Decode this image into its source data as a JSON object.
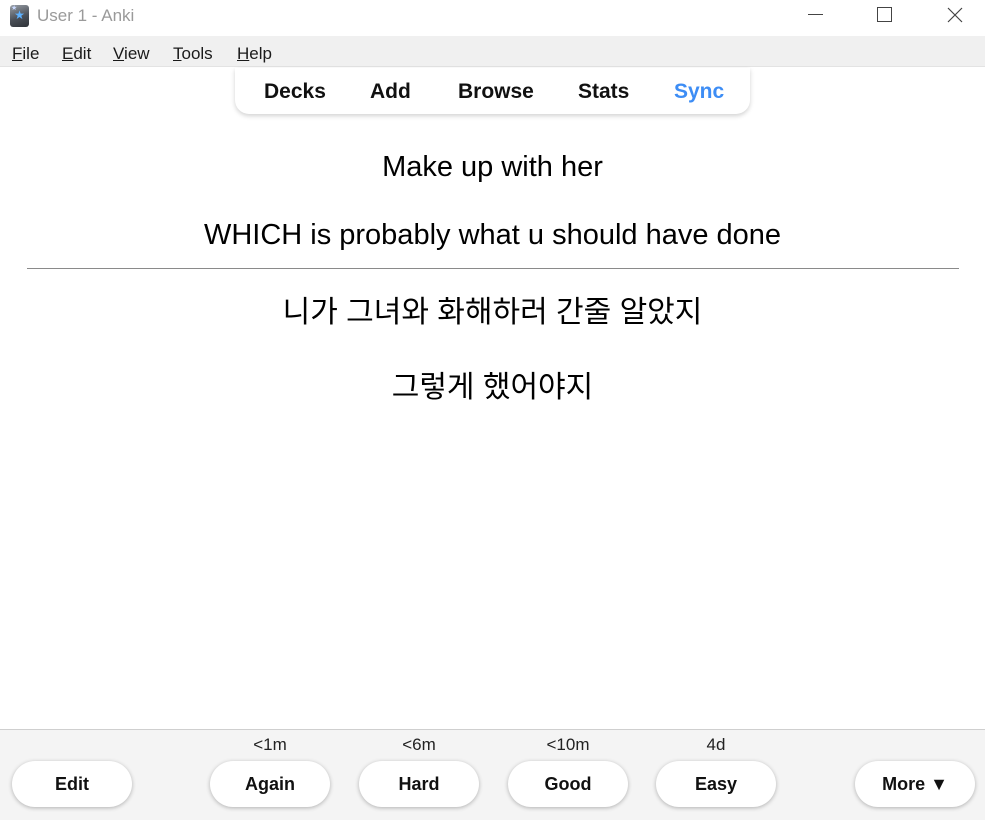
{
  "window": {
    "title": "User 1 - Anki"
  },
  "menu": {
    "items": [
      {
        "accel": "F",
        "rest": "ile"
      },
      {
        "accel": "E",
        "rest": "dit"
      },
      {
        "accel": "V",
        "rest": "iew"
      },
      {
        "accel": "T",
        "rest": "ools"
      },
      {
        "accel": "H",
        "rest": "elp"
      }
    ]
  },
  "nav": {
    "decks": "Decks",
    "add": "Add",
    "browse": "Browse",
    "stats": "Stats",
    "sync": "Sync",
    "sync_color": "#3d8df5"
  },
  "card": {
    "question": [
      "Make up with her",
      "WHICH is probably what u should have done"
    ],
    "answer": [
      "니가 그녀와 화해하러 간줄 알았지",
      "그렇게 했어야지"
    ]
  },
  "bottom": {
    "edit_label": "Edit",
    "more_label": "More ▼",
    "answers": [
      {
        "label": "Again",
        "interval": "<1m"
      },
      {
        "label": "Hard",
        "interval": "<6m"
      },
      {
        "label": "Good",
        "interval": "<10m"
      },
      {
        "label": "Easy",
        "interval": "4d"
      }
    ]
  }
}
